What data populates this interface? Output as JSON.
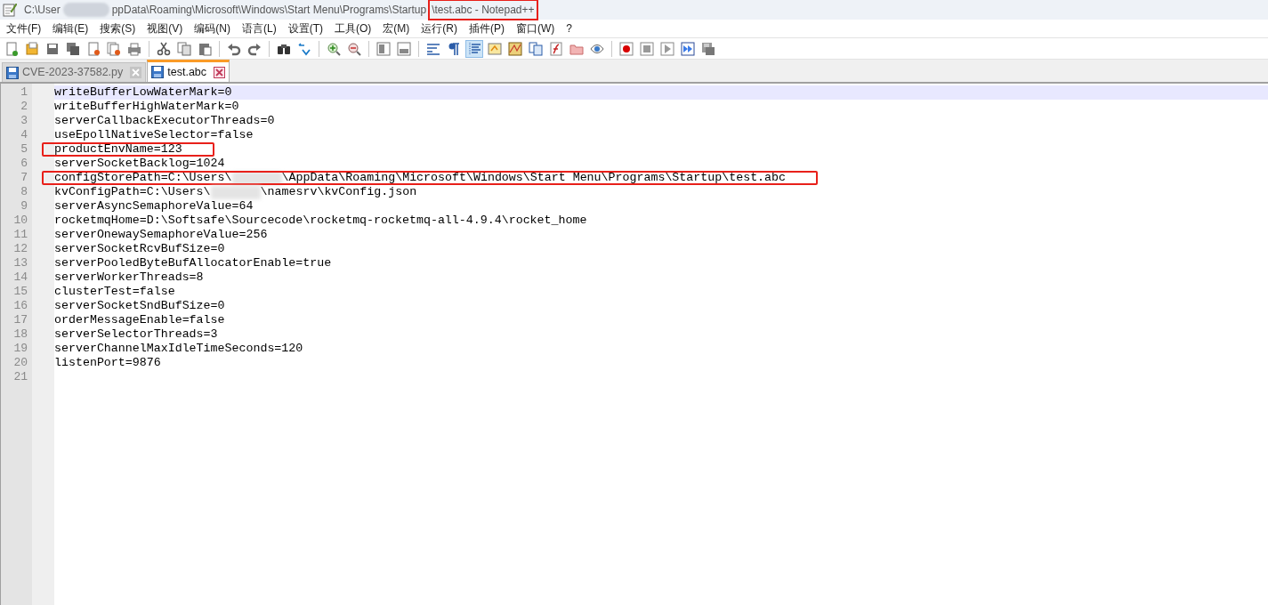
{
  "window": {
    "title": [
      {
        "kind": "text",
        "text": "C:\\User"
      },
      {
        "kind": "redaction"
      },
      {
        "kind": "text",
        "text": "ppData\\Roaming\\Microsoft\\Windows\\Start Menu\\Programs\\Startup"
      },
      {
        "kind": "text",
        "text": "\\test.abc - Notepad++",
        "highlighted": true
      }
    ]
  },
  "menu": [
    "文件(F)",
    "编辑(E)",
    "搜索(S)",
    "视图(V)",
    "编码(N)",
    "语言(L)",
    "设置(T)",
    "工具(O)",
    "宏(M)",
    "运行(R)",
    "插件(P)",
    "窗口(W)",
    "?"
  ],
  "toolbar": [
    {
      "kind": "new",
      "pressed": false
    },
    {
      "kind": "open",
      "pressed": false
    },
    {
      "kind": "save",
      "pressed": false
    },
    {
      "kind": "saveall",
      "pressed": false
    },
    {
      "kind": "close",
      "pressed": false
    },
    {
      "kind": "closeall",
      "pressed": false
    },
    {
      "kind": "print",
      "pressed": false
    },
    {
      "kind": "sep"
    },
    {
      "kind": "cut",
      "pressed": false
    },
    {
      "kind": "copy",
      "pressed": false
    },
    {
      "kind": "paste",
      "pressed": false
    },
    {
      "kind": "sep"
    },
    {
      "kind": "undo",
      "pressed": false
    },
    {
      "kind": "redo",
      "pressed": false
    },
    {
      "kind": "sep"
    },
    {
      "kind": "find",
      "pressed": false
    },
    {
      "kind": "replace",
      "pressed": false
    },
    {
      "kind": "sep"
    },
    {
      "kind": "zoomin",
      "pressed": false
    },
    {
      "kind": "zoomout",
      "pressed": false
    },
    {
      "kind": "sep"
    },
    {
      "kind": "syncv",
      "pressed": false
    },
    {
      "kind": "synch",
      "pressed": false
    },
    {
      "kind": "sep"
    },
    {
      "kind": "wrap",
      "pressed": false
    },
    {
      "kind": "pilcrow",
      "pressed": false
    },
    {
      "kind": "indent",
      "pressed": true
    },
    {
      "kind": "lang",
      "pressed": false
    },
    {
      "kind": "map",
      "pressed": false
    },
    {
      "kind": "docs",
      "pressed": false
    },
    {
      "kind": "func",
      "pressed": false
    },
    {
      "kind": "folder",
      "pressed": false
    },
    {
      "kind": "eye",
      "pressed": false
    },
    {
      "kind": "sep"
    },
    {
      "kind": "record",
      "pressed": false
    },
    {
      "kind": "stop",
      "pressed": false
    },
    {
      "kind": "play",
      "pressed": false
    },
    {
      "kind": "playmulti",
      "pressed": false
    },
    {
      "kind": "savemacro",
      "pressed": false
    }
  ],
  "tabs": [
    {
      "label": "CVE-2023-37582.py",
      "selected": false
    },
    {
      "label": "test.abc",
      "selected": true
    }
  ],
  "editor": {
    "lines": [
      {
        "number": "1",
        "current": true,
        "segments": [
          {
            "kind": "text",
            "text": "writeBufferLowWaterMark=0"
          }
        ]
      },
      {
        "number": "2",
        "current": false,
        "segments": [
          {
            "kind": "text",
            "text": "writeBufferHighWaterMark=0"
          }
        ]
      },
      {
        "number": "3",
        "current": false,
        "segments": [
          {
            "kind": "text",
            "text": "serverCallbackExecutorThreads=0"
          }
        ]
      },
      {
        "number": "4",
        "current": false,
        "segments": [
          {
            "kind": "text",
            "text": "useEpollNativeSelector=false"
          }
        ]
      },
      {
        "number": "5",
        "current": false,
        "highlighted": true,
        "segments": [
          {
            "kind": "text",
            "text": "productEnvName=123"
          }
        ]
      },
      {
        "number": "6",
        "current": false,
        "segments": [
          {
            "kind": "text",
            "text": "serverSocketBacklog=1024"
          }
        ]
      },
      {
        "number": "7",
        "current": false,
        "highlighted": true,
        "segments": [
          {
            "kind": "text",
            "text": "configStorePath=C:\\Users\\"
          },
          {
            "kind": "redaction"
          },
          {
            "kind": "text",
            "text": "\\AppData\\Roaming\\Microsoft\\Windows\\Start Menu\\Programs\\Startup\\test.abc"
          }
        ]
      },
      {
        "number": "8",
        "current": false,
        "segments": [
          {
            "kind": "text",
            "text": "kvConfigPath=C:\\Users\\"
          },
          {
            "kind": "redaction"
          },
          {
            "kind": "text",
            "text": "\\namesrv\\kvConfig.json"
          }
        ]
      },
      {
        "number": "9",
        "current": false,
        "segments": [
          {
            "kind": "text",
            "text": "serverAsyncSemaphoreValue=64"
          }
        ]
      },
      {
        "number": "10",
        "current": false,
        "segments": [
          {
            "kind": "text",
            "text": "rocketmqHome=D:\\Softsafe\\Sourcecode\\rocketmq-rocketmq-all-4.9.4\\rocket_home"
          }
        ]
      },
      {
        "number": "11",
        "current": false,
        "segments": [
          {
            "kind": "text",
            "text": "serverOnewaySemaphoreValue=256"
          }
        ]
      },
      {
        "number": "12",
        "current": false,
        "segments": [
          {
            "kind": "text",
            "text": "serverSocketRcvBufSize=0"
          }
        ]
      },
      {
        "number": "13",
        "current": false,
        "segments": [
          {
            "kind": "text",
            "text": "serverPooledByteBufAllocatorEnable=true"
          }
        ]
      },
      {
        "number": "14",
        "current": false,
        "segments": [
          {
            "kind": "text",
            "text": "serverWorkerThreads=8"
          }
        ]
      },
      {
        "number": "15",
        "current": false,
        "segments": [
          {
            "kind": "text",
            "text": "clusterTest=false"
          }
        ]
      },
      {
        "number": "16",
        "current": false,
        "segments": [
          {
            "kind": "text",
            "text": "serverSocketSndBufSize=0"
          }
        ]
      },
      {
        "number": "17",
        "current": false,
        "segments": [
          {
            "kind": "text",
            "text": "orderMessageEnable=false"
          }
        ]
      },
      {
        "number": "18",
        "current": false,
        "segments": [
          {
            "kind": "text",
            "text": "serverSelectorThreads=3"
          }
        ]
      },
      {
        "number": "19",
        "current": false,
        "segments": [
          {
            "kind": "text",
            "text": "serverChannelMaxIdleTimeSeconds=120"
          }
        ]
      },
      {
        "number": "20",
        "current": false,
        "segments": [
          {
            "kind": "text",
            "text": "listenPort=9876"
          }
        ]
      },
      {
        "number": "21",
        "current": false
      }
    ]
  }
}
